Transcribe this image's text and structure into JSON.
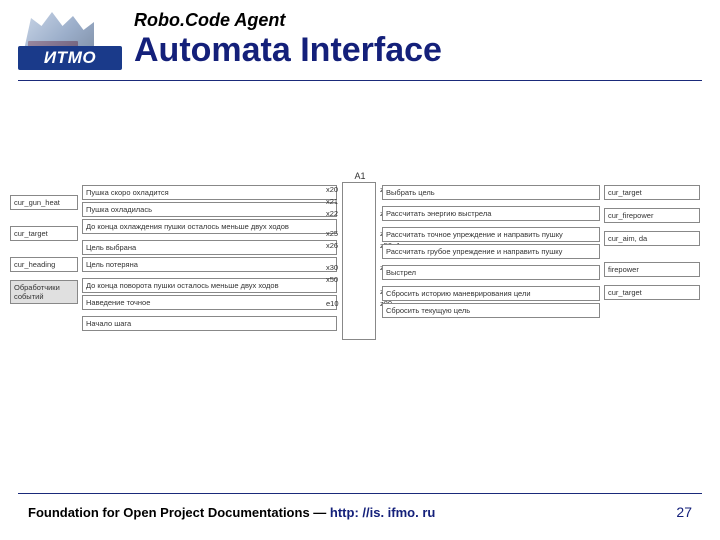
{
  "logo": {
    "text": "ИТМО"
  },
  "header": {
    "sup_title": "Robo.Code Agent",
    "main_title": "Automata Interface"
  },
  "diagram": {
    "center_label": "A1",
    "left_vars": [
      "cur_gun_heat",
      "cur_target",
      "cur_heading",
      "Обработчики событий"
    ],
    "inputs": {
      "g1": [
        "Пушка скоро охладится",
        "Пушка охладилась",
        "До конца охлаждения пушки осталось меньше двух ходов"
      ],
      "g2": [
        "Цель выбрана",
        "Цель потеряна"
      ],
      "g3": [
        "До конца поворота пушки осталось меньше двух ходов",
        "Наведение точное"
      ],
      "g4": [
        "Начало шага"
      ]
    },
    "x_in": {
      "g1": [
        "x20",
        "x21",
        "x22"
      ],
      "g2": [
        "x25",
        "x26"
      ],
      "g3": [
        "x30",
        "x50"
      ],
      "g4": [
        "e10"
      ]
    },
    "z_out": {
      "g1": [
        "z30"
      ],
      "g2": [
        "z40"
      ],
      "g3": [
        "z50",
        "z50_1"
      ],
      "g4": [
        "z60"
      ],
      "g5": [
        "z70",
        "z80"
      ]
    },
    "outputs": {
      "g1": [
        "Выбрать цель"
      ],
      "g2": [
        "Рассчитать энергию выстрела"
      ],
      "g3": [
        "Рассчитать точное упреждение и направить пушку",
        "Рассчитать грубое упреждение и направить пушку"
      ],
      "g4": [
        "Выстрел"
      ],
      "g5": [
        "Сбросить историю маневрирования цели",
        "Сбросить текущую цель"
      ]
    },
    "right_vars": [
      "cur_target",
      "cur_firepower",
      "cur_aim, da",
      "firepower",
      "cur_target"
    ]
  },
  "footer": {
    "text_prefix": "Foundation for Open Project Documentations — ",
    "link": "http: //is. ifmo. ru",
    "page": "27"
  }
}
